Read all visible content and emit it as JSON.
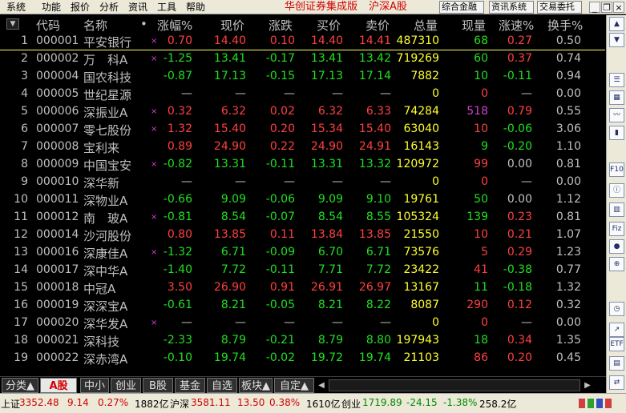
{
  "menu": [
    "系统",
    "功能",
    "报价",
    "分析",
    "资讯",
    "工具",
    "帮助"
  ],
  "app_title": "华创证券集成版",
  "market_title": "沪深A股",
  "top_buttons": [
    "综合金融",
    "资讯系统",
    "交易委托"
  ],
  "columns": [
    "代码",
    "名称",
    "•",
    "涨幅%",
    "现价",
    "涨跌",
    "买价",
    "卖价",
    "总量",
    "现量",
    "涨速%",
    "换手%"
  ],
  "rows": [
    {
      "idx": "1",
      "code": "000001",
      "name": "平安银行",
      "mark": "×",
      "pct": "0.70",
      "now": "14.40",
      "chg": "0.10",
      "buy": "14.40",
      "sell": "14.41",
      "vol": "487310",
      "cur": "68",
      "speed": "0.27",
      "turn": "0.50",
      "dir": "up",
      "cur_dir": "down",
      "speed_dir": "up"
    },
    {
      "idx": "2",
      "code": "000002",
      "name": "万　科A",
      "mark": "×",
      "pct": "-1.25",
      "now": "13.41",
      "chg": "-0.17",
      "buy": "13.41",
      "sell": "13.42",
      "vol": "719269",
      "cur": "60",
      "speed": "0.37",
      "turn": "0.74",
      "dir": "down",
      "cur_dir": "down",
      "speed_dir": "up"
    },
    {
      "idx": "3",
      "code": "000004",
      "name": "国农科技",
      "mark": "",
      "pct": "-0.87",
      "now": "17.13",
      "chg": "-0.15",
      "buy": "17.13",
      "sell": "17.14",
      "vol": "7882",
      "cur": "10",
      "speed": "-0.11",
      "turn": "0.94",
      "dir": "down",
      "cur_dir": "down",
      "speed_dir": "down"
    },
    {
      "idx": "4",
      "code": "000005",
      "name": "世纪星源",
      "mark": "",
      "pct": "—",
      "now": "—",
      "chg": "—",
      "buy": "—",
      "sell": "—",
      "vol": "0",
      "cur": "0",
      "speed": "—",
      "turn": "0.00",
      "dir": "flat",
      "cur_dir": "up",
      "speed_dir": "flat"
    },
    {
      "idx": "5",
      "code": "000006",
      "name": "深振业A",
      "mark": "×",
      "pct": "0.32",
      "now": "6.32",
      "chg": "0.02",
      "buy": "6.32",
      "sell": "6.33",
      "vol": "74284",
      "cur": "518",
      "speed": "0.79",
      "turn": "0.55",
      "dir": "up",
      "cur_dir": "mag",
      "speed_dir": "up"
    },
    {
      "idx": "6",
      "code": "000007",
      "name": "零七股份",
      "mark": "×",
      "pct": "1.32",
      "now": "15.40",
      "chg": "0.20",
      "buy": "15.34",
      "sell": "15.40",
      "vol": "63040",
      "cur": "10",
      "speed": "-0.06",
      "turn": "3.06",
      "dir": "up",
      "cur_dir": "up",
      "speed_dir": "down"
    },
    {
      "idx": "7",
      "code": "000008",
      "name": "宝利来",
      "mark": "",
      "pct": "0.89",
      "now": "24.90",
      "chg": "0.22",
      "buy": "24.90",
      "sell": "24.91",
      "vol": "16143",
      "cur": "9",
      "speed": "-0.20",
      "turn": "1.10",
      "dir": "up",
      "cur_dir": "down",
      "speed_dir": "down"
    },
    {
      "idx": "8",
      "code": "000009",
      "name": "中国宝安",
      "mark": "×",
      "pct": "-0.82",
      "now": "13.31",
      "chg": "-0.11",
      "buy": "13.31",
      "sell": "13.32",
      "vol": "120972",
      "cur": "99",
      "speed": "0.00",
      "turn": "0.81",
      "dir": "down",
      "cur_dir": "up",
      "speed_dir": "flat"
    },
    {
      "idx": "9",
      "code": "000010",
      "name": "深华新",
      "mark": "",
      "pct": "—",
      "now": "—",
      "chg": "—",
      "buy": "—",
      "sell": "—",
      "vol": "0",
      "cur": "0",
      "speed": "—",
      "turn": "0.00",
      "dir": "flat",
      "cur_dir": "up",
      "speed_dir": "flat"
    },
    {
      "idx": "10",
      "code": "000011",
      "name": "深物业A",
      "mark": "",
      "pct": "-0.66",
      "now": "9.09",
      "chg": "-0.06",
      "buy": "9.09",
      "sell": "9.10",
      "vol": "19761",
      "cur": "50",
      "speed": "0.00",
      "turn": "1.12",
      "dir": "down",
      "cur_dir": "down",
      "speed_dir": "flat"
    },
    {
      "idx": "11",
      "code": "000012",
      "name": "南　玻A",
      "mark": "×",
      "pct": "-0.81",
      "now": "8.54",
      "chg": "-0.07",
      "buy": "8.54",
      "sell": "8.55",
      "vol": "105324",
      "cur": "139",
      "speed": "0.23",
      "turn": "0.81",
      "dir": "down",
      "cur_dir": "down",
      "speed_dir": "up"
    },
    {
      "idx": "12",
      "code": "000014",
      "name": "沙河股份",
      "mark": "",
      "pct": "0.80",
      "now": "13.85",
      "chg": "0.11",
      "buy": "13.84",
      "sell": "13.85",
      "vol": "21550",
      "cur": "10",
      "speed": "0.21",
      "turn": "1.07",
      "dir": "up",
      "cur_dir": "up",
      "speed_dir": "up"
    },
    {
      "idx": "13",
      "code": "000016",
      "name": "深康佳A",
      "mark": "×",
      "pct": "-1.32",
      "now": "6.71",
      "chg": "-0.09",
      "buy": "6.70",
      "sell": "6.71",
      "vol": "73576",
      "cur": "5",
      "speed": "0.29",
      "turn": "1.23",
      "dir": "down",
      "cur_dir": "up",
      "speed_dir": "up"
    },
    {
      "idx": "14",
      "code": "000017",
      "name": "深中华A",
      "mark": "",
      "pct": "-1.40",
      "now": "7.72",
      "chg": "-0.11",
      "buy": "7.71",
      "sell": "7.72",
      "vol": "23422",
      "cur": "41",
      "speed": "-0.38",
      "turn": "0.77",
      "dir": "down",
      "cur_dir": "up",
      "speed_dir": "down"
    },
    {
      "idx": "15",
      "code": "000018",
      "name": "中冠A",
      "mark": "",
      "pct": "3.50",
      "now": "26.90",
      "chg": "0.91",
      "buy": "26.91",
      "sell": "26.97",
      "vol": "13167",
      "cur": "11",
      "speed": "-0.18",
      "turn": "1.32",
      "dir": "up",
      "cur_dir": "down",
      "speed_dir": "down"
    },
    {
      "idx": "16",
      "code": "000019",
      "name": "深深宝A",
      "mark": "",
      "pct": "-0.61",
      "now": "8.21",
      "chg": "-0.05",
      "buy": "8.21",
      "sell": "8.22",
      "vol": "8087",
      "cur": "290",
      "speed": "0.12",
      "turn": "0.32",
      "dir": "down",
      "cur_dir": "up",
      "speed_dir": "up"
    },
    {
      "idx": "17",
      "code": "000020",
      "name": "深华发A",
      "mark": "×",
      "pct": "—",
      "now": "—",
      "chg": "—",
      "buy": "—",
      "sell": "—",
      "vol": "0",
      "cur": "0",
      "speed": "—",
      "turn": "0.00",
      "dir": "flat",
      "cur_dir": "up",
      "speed_dir": "flat"
    },
    {
      "idx": "18",
      "code": "000021",
      "name": "深科技",
      "mark": "",
      "pct": "-2.33",
      "now": "8.79",
      "chg": "-0.21",
      "buy": "8.79",
      "sell": "8.80",
      "vol": "197943",
      "cur": "18",
      "speed": "0.34",
      "turn": "1.35",
      "dir": "down",
      "cur_dir": "down",
      "speed_dir": "up"
    },
    {
      "idx": "19",
      "code": "000022",
      "name": "深赤湾A",
      "mark": "",
      "pct": "-0.10",
      "now": "19.74",
      "chg": "-0.02",
      "buy": "19.72",
      "sell": "19.74",
      "vol": "21103",
      "cur": "86",
      "speed": "0.20",
      "turn": "0.45",
      "dir": "down",
      "cur_dir": "up",
      "speed_dir": "up"
    }
  ],
  "tabs": [
    "分类▲",
    "A股",
    "中小",
    "创业",
    "B股",
    "基金",
    "自选",
    "板块▲",
    "自定▲"
  ],
  "active_tab": 1,
  "status": {
    "sh_label": "上证",
    "sh_val": "3352.48",
    "sh_chg": "9.14",
    "sh_pct": "0.27%",
    "sh_amt": "1882亿",
    "hs_label": "沪深",
    "hs_val": "3581.11",
    "hs_chg": "13.50",
    "hs_pct": "0.38%",
    "hs_amt": "1610亿",
    "cy_label": "创业",
    "cy_val": "1719.89",
    "cy_chg": "-24.15",
    "cy_pct": "-1.38%",
    "cy_amt": "258.2亿"
  },
  "toolbar_icons": [
    "scroll-up-icon",
    "scroll-down-icon",
    "list-icon",
    "grid-icon",
    "minute-chart-icon",
    "candlestick-icon",
    "f10-icon",
    "info-icon",
    "bar-chart-icon",
    "fiz-icon",
    "record-icon",
    "zoom-icon",
    "clock-icon",
    "chart-icon",
    "etf-icon",
    "calendar-icon",
    "trade-icon"
  ],
  "colors": {
    "up": "#ff4040",
    "down": "#20e020",
    "volume": "#ffff30",
    "title": "#d40000"
  }
}
